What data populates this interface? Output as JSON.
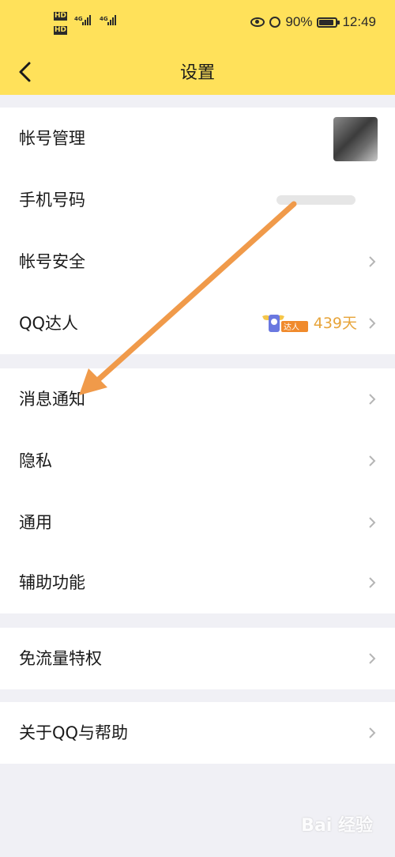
{
  "status": {
    "battery": "90%",
    "time": "12:49",
    "hd": "HD",
    "net": "4G",
    "battery_level": 0.9
  },
  "header": {
    "title": "设置"
  },
  "sections": [
    {
      "items": [
        {
          "label": "帐号管理"
        },
        {
          "label": "手机号码"
        },
        {
          "label": "帐号安全"
        },
        {
          "label": "QQ达人",
          "badge": "达人",
          "days": "439天"
        }
      ]
    },
    {
      "items": [
        {
          "label": "消息通知"
        },
        {
          "label": "隐私"
        },
        {
          "label": "通用"
        },
        {
          "label": "辅助功能"
        }
      ]
    },
    {
      "items": [
        {
          "label": "免流量特权"
        }
      ]
    },
    {
      "items": [
        {
          "label": "关于QQ与帮助"
        }
      ]
    }
  ],
  "watermark": "Bai 经验",
  "colors": {
    "header_bg": "#ffe15a",
    "accent": "#e7a43a",
    "annotation_arrow": "#f09a4a"
  }
}
